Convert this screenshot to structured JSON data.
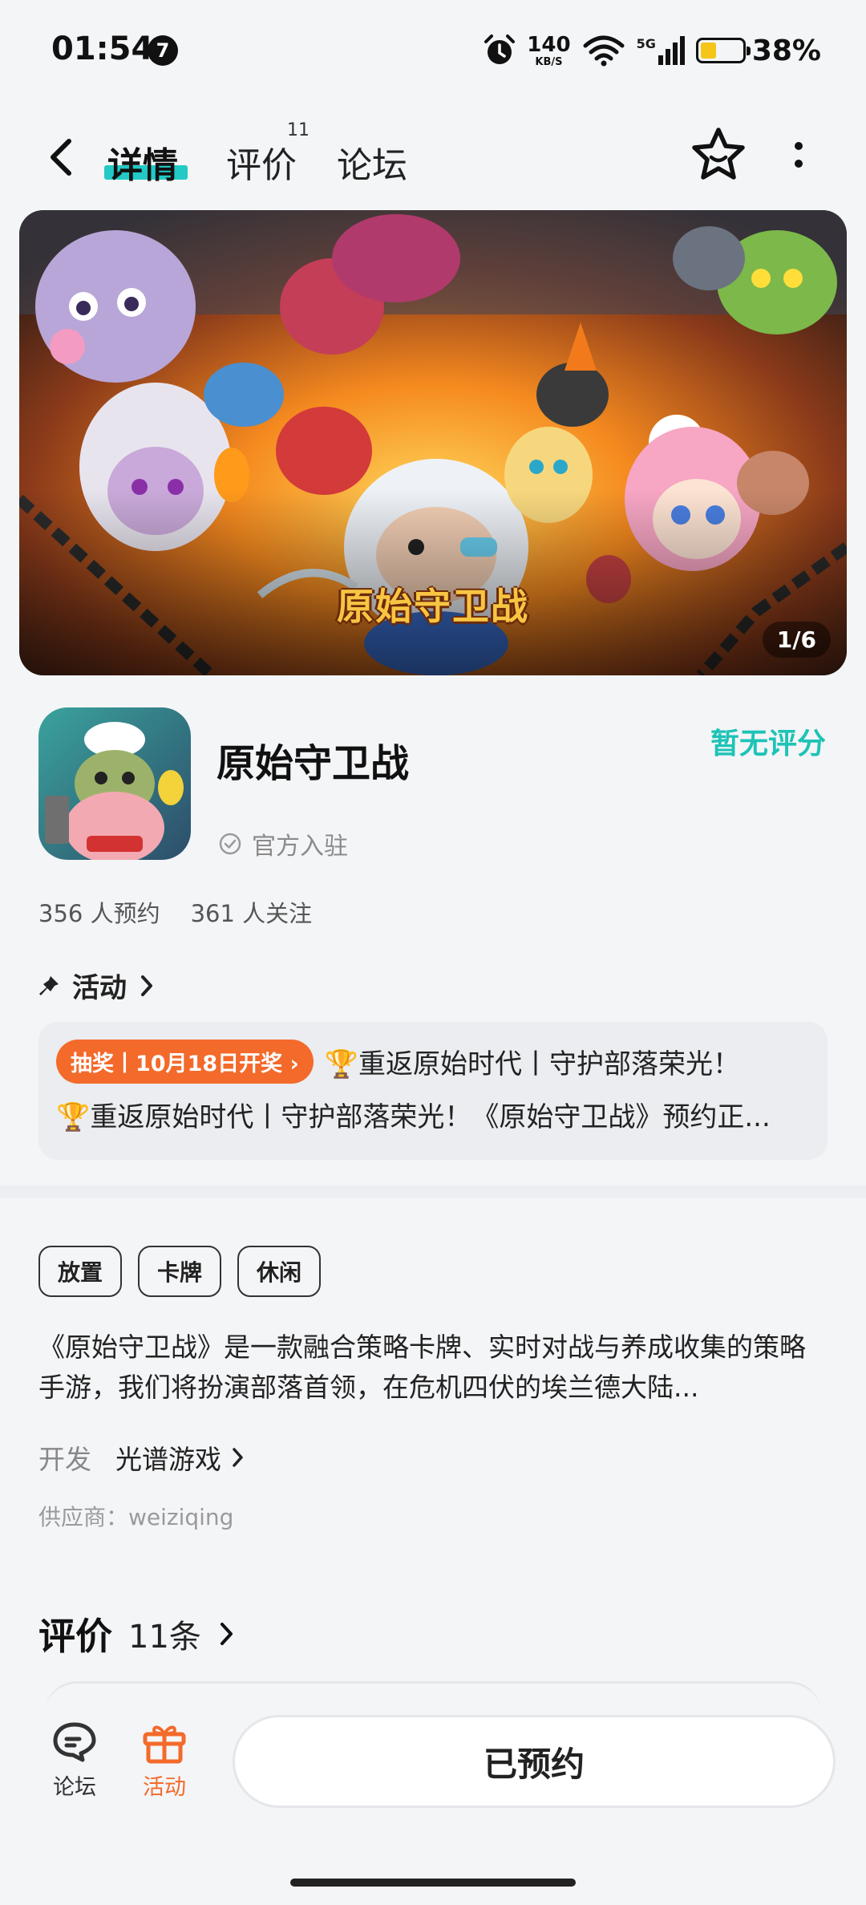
{
  "status_bar": {
    "time": "01:54",
    "notification_count": "7",
    "net_speed_value": "140",
    "net_speed_unit": "KB/S",
    "signal_label": "5G",
    "battery_percent": "38%",
    "battery_level": 0.38,
    "battery_color": "#f5c518"
  },
  "nav": {
    "tabs": [
      {
        "label": "详情",
        "active": true
      },
      {
        "label": "评价",
        "badge": "11"
      },
      {
        "label": "论坛"
      }
    ],
    "accent": "#22c9c5",
    "icons": [
      "back-icon",
      "star-icon",
      "more-icon"
    ]
  },
  "banner": {
    "logo_text": "原始守卫战",
    "counter": "1/6"
  },
  "app": {
    "name": "原始守卫战",
    "verified": "官方入驻",
    "rating": "暂无评分",
    "rating_color": "#1ec3b7",
    "reservations": "356 人预约",
    "followers": "361 人关注"
  },
  "activity": {
    "header": "活动",
    "tag": "抽奖丨10月18日开奖",
    "tag_color": "#f36a2b",
    "line1": "🏆重返原始时代丨守护部落荣光！",
    "line2": "🏆重返原始时代丨守护部落荣光！《原始守卫战》预约正..."
  },
  "tags": [
    "放置",
    "卡牌",
    "休闲"
  ],
  "description": "《原始守卫战》是一款融合策略卡牌、实时对战与养成收集的策略手游，我们将扮演部落首领，在危机四伏的埃兰德大陆...",
  "developer": {
    "label": "开发",
    "name": "光谱游戏"
  },
  "supplier": "供应商：weiziqing",
  "reviews": {
    "title": "评价",
    "count": "11条"
  },
  "bottom_bar": {
    "forum_label": "论坛",
    "activity_label": "活动",
    "reserve_button": "已预约"
  }
}
